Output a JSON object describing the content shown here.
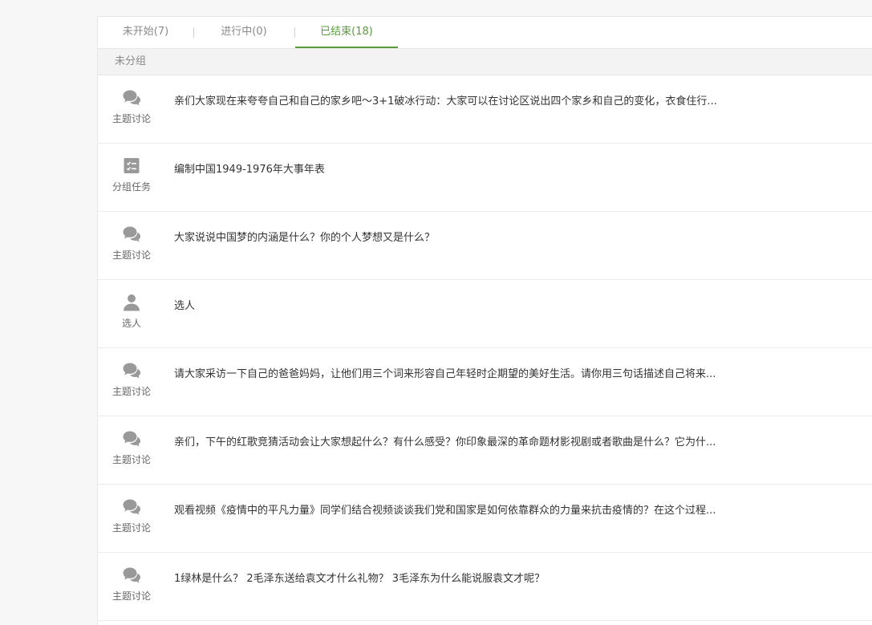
{
  "tabs": [
    {
      "label": "未开始(7)",
      "active": false
    },
    {
      "label": "进行中(0)",
      "active": false
    },
    {
      "label": "已结束(18)",
      "active": true
    }
  ],
  "accent_color": "#5a9c3c",
  "group": {
    "label": "未分组"
  },
  "items": [
    {
      "icon": "chat-bubbles-icon",
      "type": "主题讨论",
      "title": "亲们大家现在来夸夸自己和自己的家乡吧～3+1破冰行动：大家可以在讨论区说出四个家乡和自己的变化，衣食住行..."
    },
    {
      "icon": "task-checklist-icon",
      "type": "分组任务",
      "title": "编制中国1949-1976年大事年表"
    },
    {
      "icon": "chat-bubbles-icon",
      "type": "主题讨论",
      "title": "大家说说中国梦的内涵是什么？你的个人梦想又是什么？"
    },
    {
      "icon": "person-icon",
      "type": "选人",
      "title": "选人"
    },
    {
      "icon": "chat-bubbles-icon",
      "type": "主题讨论",
      "title": "请大家采访一下自己的爸爸妈妈，让他们用三个词来形容自己年轻时企期望的美好生活。请你用三句话描述自己将来..."
    },
    {
      "icon": "chat-bubbles-icon",
      "type": "主题讨论",
      "title": "亲们，下午的红歌竞猜活动会让大家想起什么？有什么感受？你印象最深的革命题材影视剧或者歌曲是什么？它为什..."
    },
    {
      "icon": "chat-bubbles-icon",
      "type": "主题讨论",
      "title": "观看视频《疫情中的平凡力量》同学们结合视频谈谈我们党和国家是如何依靠群众的力量来抗击疫情的？在这个过程..."
    },
    {
      "icon": "chat-bubbles-icon",
      "type": "主题讨论",
      "title": "1绿林是什么？ 2毛泽东送给袁文才什么礼物？ 3毛泽东为什么能说服袁文才呢？"
    }
  ]
}
